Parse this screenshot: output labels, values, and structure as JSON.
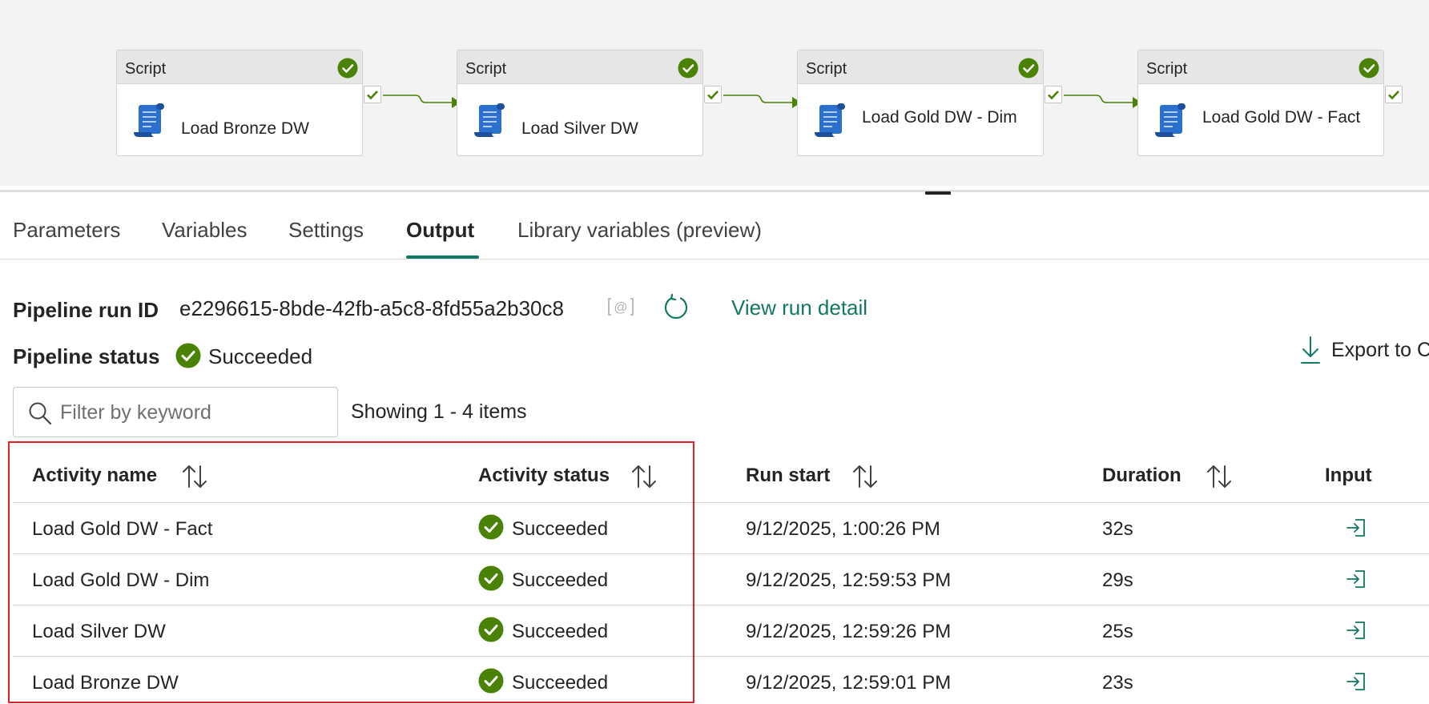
{
  "pipeline": {
    "nodes": [
      {
        "type": "Script",
        "name": "Load Bronze DW"
      },
      {
        "type": "Script",
        "name": "Load Silver DW"
      },
      {
        "type": "Script",
        "name": "Load Gold DW - Dim"
      },
      {
        "type": "Script",
        "name": "Load Gold DW - Fact"
      }
    ]
  },
  "tabs": [
    {
      "label": "Parameters"
    },
    {
      "label": "Variables"
    },
    {
      "label": "Settings"
    },
    {
      "label": "Output"
    },
    {
      "label": "Library variables (preview)"
    }
  ],
  "active_tab": "Output",
  "run": {
    "id_label": "Pipeline run ID",
    "id_value": "e2296615-8bde-42fb-a5c8-8fd55a2b30c8",
    "view_detail": "View run detail",
    "status_label": "Pipeline status",
    "status_value": "Succeeded",
    "export_label": "Export to CSV"
  },
  "filter": {
    "placeholder": "Filter by keyword",
    "showing": "Showing 1 - 4 items"
  },
  "table": {
    "columns": [
      "Activity name",
      "Activity status",
      "Run start",
      "Duration",
      "Input"
    ],
    "rows": [
      {
        "name": "Load Gold DW - Fact",
        "status": "Succeeded",
        "run_start": "9/12/2025, 1:00:26 PM",
        "duration": "32s"
      },
      {
        "name": "Load Gold DW - Dim",
        "status": "Succeeded",
        "run_start": "9/12/2025, 12:59:53 PM",
        "duration": "29s"
      },
      {
        "name": "Load Silver DW",
        "status": "Succeeded",
        "run_start": "9/12/2025, 12:59:26 PM",
        "duration": "25s"
      },
      {
        "name": "Load Bronze DW",
        "status": "Succeeded",
        "run_start": "9/12/2025, 12:59:01 PM",
        "duration": "23s"
      }
    ]
  },
  "colors": {
    "accent": "#117865",
    "success": "#498205",
    "highlight": "#e0202a",
    "script_icon": "#2b6fcf"
  },
  "icons": {
    "node_status": "check-circle-icon",
    "node_activity": "script-icon",
    "port": "success-port-icon",
    "copy": "copy-icon",
    "refresh": "refresh-icon",
    "export": "download-icon",
    "filter": "search-icon",
    "sort": "sort-icon",
    "input": "input-icon"
  }
}
